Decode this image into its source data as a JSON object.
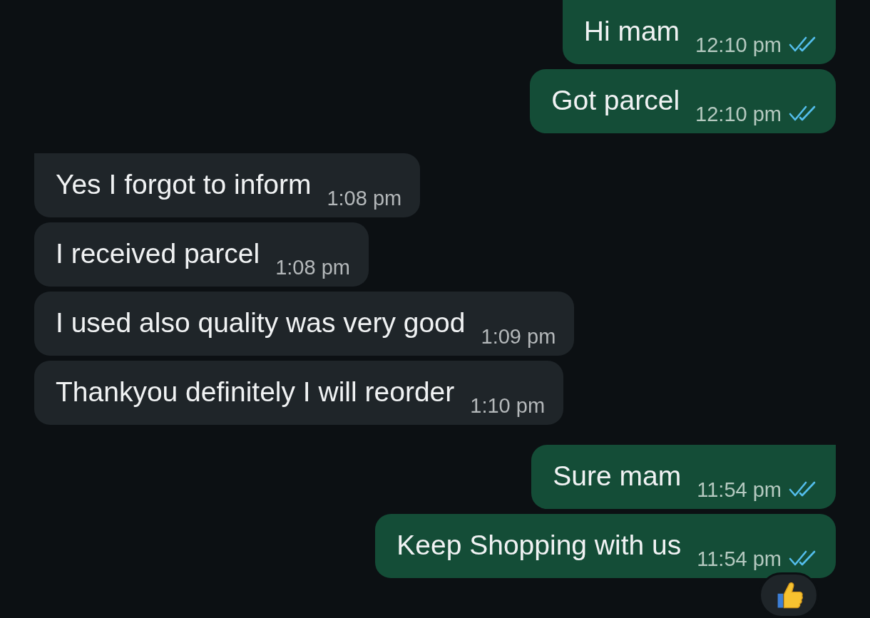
{
  "messages": [
    {
      "kind": "outgoing",
      "text": "Hi mam",
      "time": "12:10 pm",
      "read": true,
      "tail": true
    },
    {
      "kind": "outgoing",
      "text": "Got parcel",
      "time": "12:10 pm",
      "read": true,
      "tail": false
    },
    {
      "kind": "incoming",
      "text": "Yes I forgot to inform",
      "time": "1:08 pm",
      "tail": true
    },
    {
      "kind": "incoming",
      "text": "I received parcel",
      "time": "1:08 pm",
      "tail": false
    },
    {
      "kind": "incoming",
      "text": "I used also quality was very good",
      "time": "1:09 pm",
      "tail": false
    },
    {
      "kind": "incoming",
      "text": "Thankyou definitely I will reorder",
      "time": "1:10 pm",
      "tail": false
    },
    {
      "kind": "outgoing",
      "text": "Sure mam",
      "time": "11:54 pm",
      "read": true,
      "tail": true
    },
    {
      "kind": "outgoing",
      "text": "Keep Shopping with us",
      "time": "11:54 pm",
      "read": true,
      "tail": false,
      "reacted": true
    }
  ]
}
